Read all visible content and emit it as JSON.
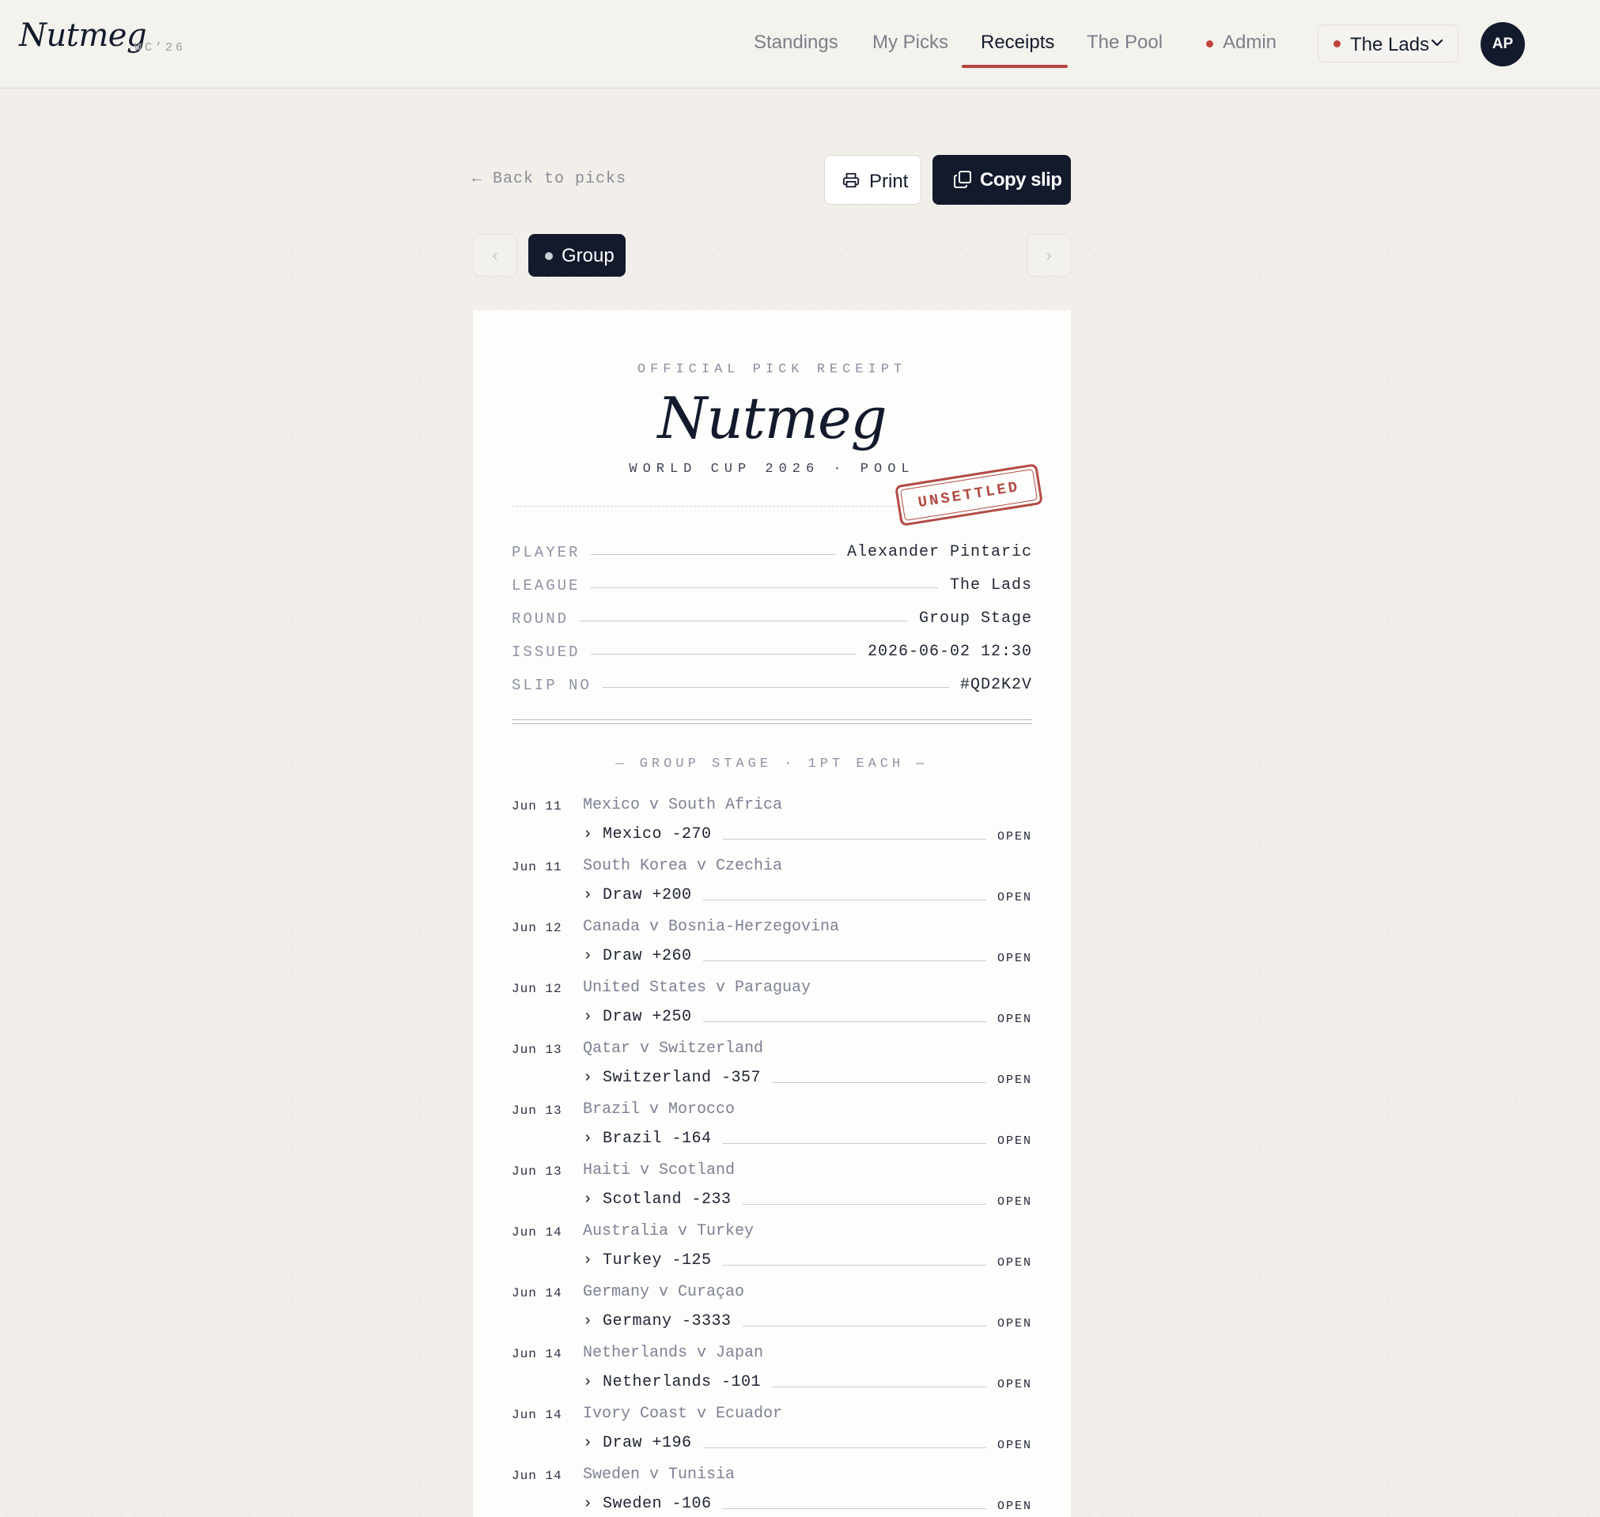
{
  "header": {
    "brand": "Nutmeg",
    "brand_sub": "WC’26",
    "nav": [
      {
        "label": "Standings"
      },
      {
        "label": "My Picks"
      },
      {
        "label": "Receipts"
      },
      {
        "label": "The Pool"
      },
      {
        "label": "Admin"
      }
    ],
    "active_nav": "Receipts",
    "league_select": "The Lads",
    "avatar_initials": "AP"
  },
  "actions": {
    "back": "← Back to picks",
    "print": "Print",
    "copy": "Copy slip"
  },
  "rounds": {
    "active_label": "Group"
  },
  "receipt": {
    "kicker": "OFFICIAL PICK RECEIPT",
    "title": "Nutmeg",
    "subtitle": "WORLD CUP 2026 · POOL",
    "stamp": "UNSETTLED",
    "fields": [
      {
        "key": "PLAYER",
        "value": "Alexander Pintaric"
      },
      {
        "key": "LEAGUE",
        "value": "The Lads"
      },
      {
        "key": "ROUND",
        "value": "Group Stage"
      },
      {
        "key": "ISSUED",
        "value": "2026-06-02 12:30"
      },
      {
        "key": "SLIP NO",
        "value": "#QD2K2V"
      }
    ],
    "section_title": "— GROUP STAGE · 1PT EACH —",
    "picks": [
      {
        "date": "Jun 11",
        "match": "Mexico v South Africa",
        "selection": "› Mexico -270",
        "status": "OPEN"
      },
      {
        "date": "Jun 11",
        "match": "South Korea v Czechia",
        "selection": "› Draw +200",
        "status": "OPEN"
      },
      {
        "date": "Jun 12",
        "match": "Canada v Bosnia-Herzegovina",
        "selection": "› Draw +260",
        "status": "OPEN"
      },
      {
        "date": "Jun 12",
        "match": "United States v Paraguay",
        "selection": "› Draw +250",
        "status": "OPEN"
      },
      {
        "date": "Jun 13",
        "match": "Qatar v Switzerland",
        "selection": "› Switzerland -357",
        "status": "OPEN"
      },
      {
        "date": "Jun 13",
        "match": "Brazil v Morocco",
        "selection": "› Brazil -164",
        "status": "OPEN"
      },
      {
        "date": "Jun 13",
        "match": "Haiti v Scotland",
        "selection": "› Scotland -233",
        "status": "OPEN"
      },
      {
        "date": "Jun 14",
        "match": "Australia v Turkey",
        "selection": "› Turkey -125",
        "status": "OPEN"
      },
      {
        "date": "Jun 14",
        "match": "Germany v Curaçao",
        "selection": "› Germany -3333",
        "status": "OPEN"
      },
      {
        "date": "Jun 14",
        "match": "Netherlands v Japan",
        "selection": "› Netherlands -101",
        "status": "OPEN"
      },
      {
        "date": "Jun 14",
        "match": "Ivory Coast v Ecuador",
        "selection": "› Draw +196",
        "status": "OPEN"
      },
      {
        "date": "Jun 14",
        "match": "Sweden v Tunisia",
        "selection": "› Sweden -106",
        "status": "OPEN"
      }
    ]
  },
  "colors": {
    "accent": "#b6453f",
    "ink": "#121a2c",
    "background": "#f2efea",
    "paper": "#fdfdfb"
  }
}
